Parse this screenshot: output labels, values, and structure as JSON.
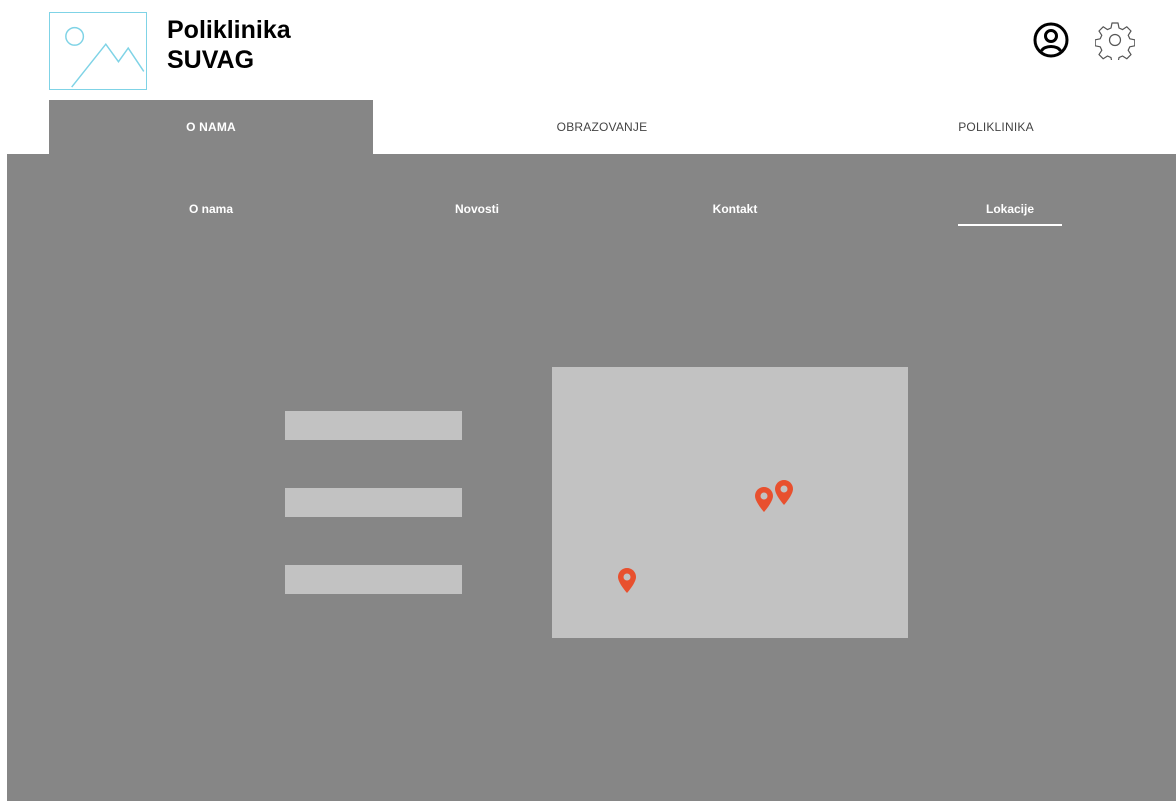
{
  "header": {
    "brand_line1": "Poliklinika",
    "brand_line2": "SUVAG",
    "logo_icon": "image-placeholder-icon",
    "profile_icon": "user-circle-icon",
    "settings_icon": "gear-icon"
  },
  "main_tabs": [
    {
      "label": "O NAMA",
      "active": true
    },
    {
      "label": "OBRAZOVANJE",
      "active": false
    },
    {
      "label": "POLIKLINIKA",
      "active": false
    }
  ],
  "sub_tabs": [
    {
      "label": "O nama",
      "active": false
    },
    {
      "label": "Novosti",
      "active": false
    },
    {
      "label": "Kontakt",
      "active": false
    },
    {
      "label": "Lokacije",
      "active": true
    }
  ],
  "locations": {
    "list_items": 3,
    "map_pins": 3,
    "pin_icon": "map-pin-icon"
  },
  "colors": {
    "panel": "#868686",
    "placeholder": "#c2c2c2",
    "pin": "#e8502e",
    "logo_outline": "#7fd3e6"
  }
}
